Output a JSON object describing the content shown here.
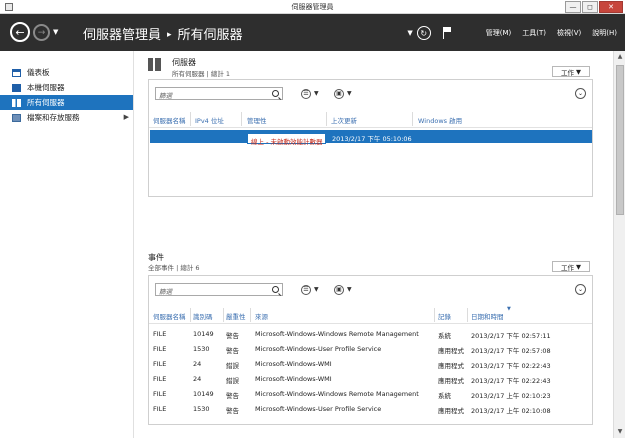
{
  "window": {
    "title": "伺服器管理員",
    "controls": {
      "minimize": "—",
      "maximize": "◻",
      "close": "✕"
    }
  },
  "header": {
    "breadcrumb_root": "伺服器管理員",
    "breadcrumb_sep": "▸",
    "breadcrumb_current": "所有伺服器",
    "menu": [
      "管理(M)",
      "工具(T)",
      "檢視(V)",
      "說明(H)"
    ]
  },
  "sidebar": {
    "items": [
      {
        "label": "儀表板",
        "icon": "dashboard-icon"
      },
      {
        "label": "本機伺服器",
        "icon": "local-server-icon"
      },
      {
        "label": "所有伺服器",
        "icon": "all-servers-icon",
        "active": true
      },
      {
        "label": "檔案和存放服務",
        "icon": "file-storage-icon",
        "has_submenu": true
      }
    ]
  },
  "servers": {
    "title": "伺服器",
    "subtitle": "所有伺服器 | 總計 1",
    "tasks_label": "工作",
    "filter_placeholder": "篩選",
    "columns": [
      "伺服器名稱",
      "IPv4 位址",
      "管理性",
      "上次更新",
      "Windows 啟用"
    ],
    "rows": [
      {
        "name": "",
        "ipv4": "",
        "manageability": "線上 - 未啟動效能計數器",
        "last_update": "2013/2/17 下午 05:10:06",
        "activation": ""
      }
    ]
  },
  "events": {
    "title": "事件",
    "subtitle": "全部事件 | 總計 6",
    "tasks_label": "工作",
    "filter_placeholder": "篩選",
    "columns": [
      "伺服器名稱",
      "識別碼",
      "嚴重性",
      "來源",
      "記錄",
      "日期和時間"
    ],
    "rows": [
      {
        "server": "FILE",
        "id": "10149",
        "severity": "警告",
        "source": "Microsoft-Windows-Windows Remote Management",
        "log": "系統",
        "datetime": "2013/2/17 下午 02:57:11"
      },
      {
        "server": "FILE",
        "id": "1530",
        "severity": "警告",
        "source": "Microsoft-Windows-User Profile Service",
        "log": "應用程式",
        "datetime": "2013/2/17 下午 02:57:08"
      },
      {
        "server": "FILE",
        "id": "24",
        "severity": "錯誤",
        "source": "Microsoft-Windows-WMI",
        "log": "應用程式",
        "datetime": "2013/2/17 下午 02:22:43"
      },
      {
        "server": "FILE",
        "id": "24",
        "severity": "錯誤",
        "source": "Microsoft-Windows-WMI",
        "log": "應用程式",
        "datetime": "2013/2/17 下午 02:22:43"
      },
      {
        "server": "FILE",
        "id": "10149",
        "severity": "警告",
        "source": "Microsoft-Windows-Windows Remote Management",
        "log": "系統",
        "datetime": "2013/2/17 上午 02:10:23"
      },
      {
        "server": "FILE",
        "id": "1530",
        "severity": "警告",
        "source": "Microsoft-Windows-User Profile Service",
        "log": "應用程式",
        "datetime": "2013/2/17 上午 02:10:08"
      }
    ]
  },
  "colors": {
    "accent": "#1e73be",
    "header_bg": "#2e2e2e",
    "link_text": "#3b6fb0",
    "warning_text": "#c42b1c"
  }
}
